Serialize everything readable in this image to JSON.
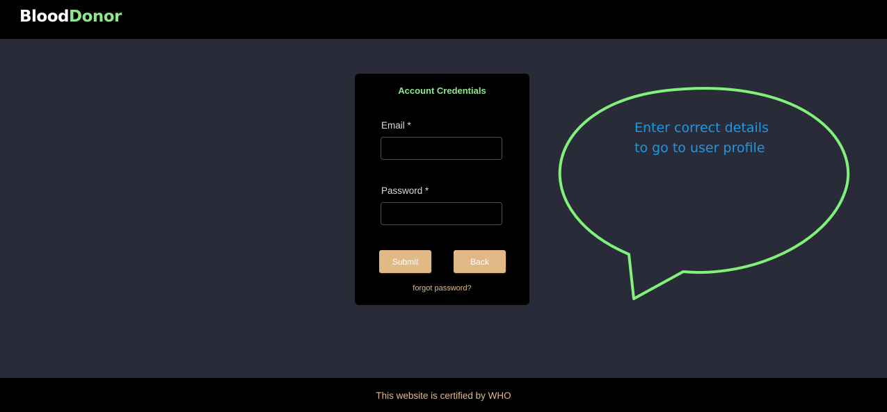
{
  "header": {
    "brand_part1": "Blood",
    "brand_part2": "Donor"
  },
  "login_card": {
    "title": "Account Credentials",
    "email_label": "Email *",
    "email_value": "",
    "password_label": "Password *",
    "password_value": "",
    "submit_label": "Submit",
    "back_label": "Back",
    "forgot_label": "forgot password?"
  },
  "callout": {
    "line1": "Enter correct details",
    "line2": "to go to user profile"
  },
  "footer": {
    "text": "This website is certified by WHO"
  },
  "colors": {
    "page_background": "#292b39",
    "bar_background": "#000000",
    "brand_accent": "#8ee78d",
    "button_fill": "#e0b987",
    "callout_outline": "#80f27a",
    "callout_text": "#1b9ae3",
    "input_border": "#2b4fae"
  }
}
